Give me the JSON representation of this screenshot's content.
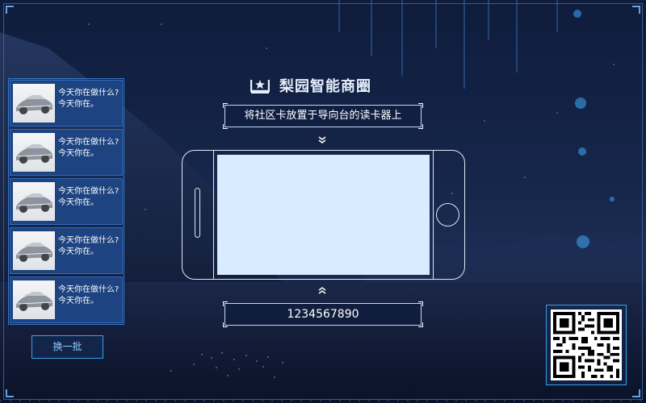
{
  "brand": {
    "title": "梨园智能商圈",
    "logo_icon": "store-logo-icon"
  },
  "instruction": "将社区卡放置于导向台的读卡器上",
  "card_number": "1234567890",
  "sidebar": {
    "items": [
      {
        "thumb": "car-image",
        "line1": "今天你在做什么?",
        "line2": "今天你在。"
      },
      {
        "thumb": "car-image",
        "line1": "今天你在做什么?",
        "line2": "今天你在。"
      },
      {
        "thumb": "car-image",
        "line1": "今天你在做什么?",
        "line2": "今天你在。"
      },
      {
        "thumb": "car-image",
        "line1": "今天你在做什么?",
        "line2": "今天你在。"
      },
      {
        "thumb": "car-image",
        "line1": "今天你在做什么?",
        "line2": "今天你在。"
      }
    ],
    "refresh_label": "换一批"
  },
  "qr_code": {
    "icon": "qr-code-icon"
  },
  "colors": {
    "background": "#16264a",
    "card": "#1d4380",
    "accent": "#3aa0e8",
    "screen": "#d9ecff"
  }
}
